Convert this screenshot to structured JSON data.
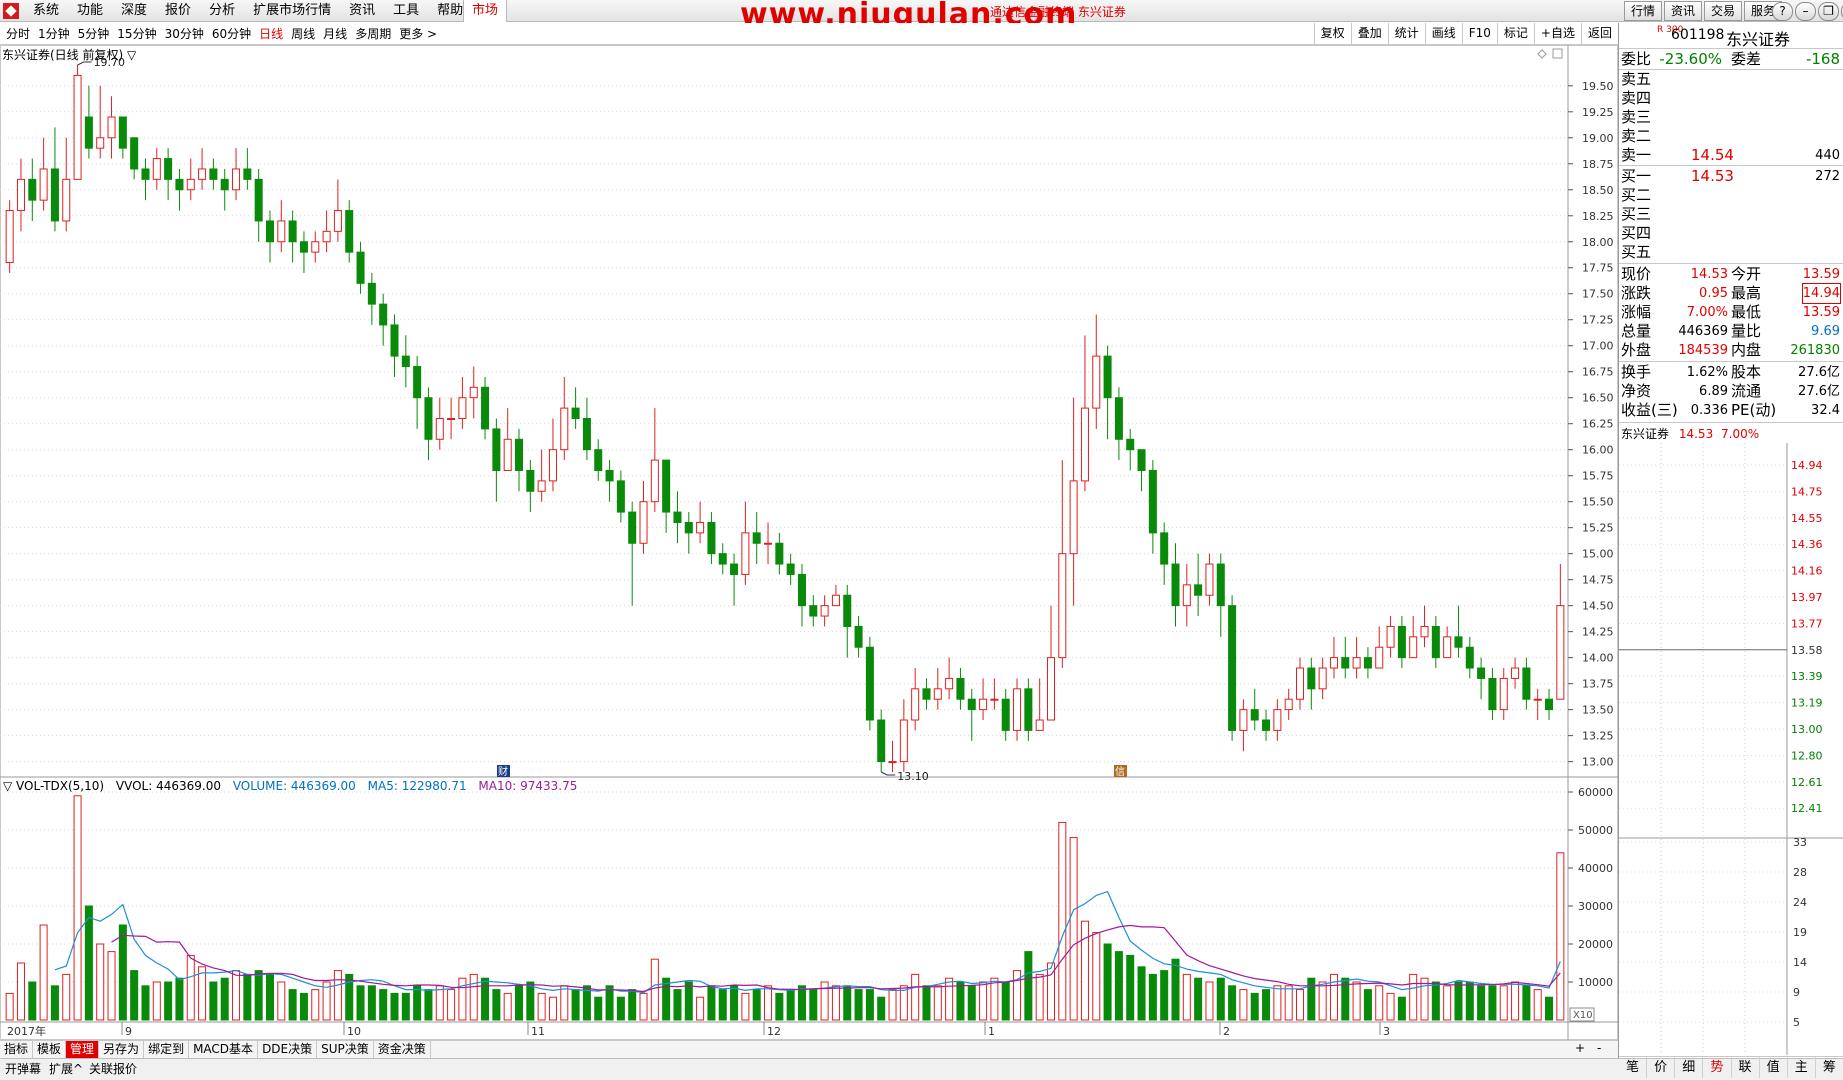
{
  "menubar": {
    "items": [
      "系统",
      "功能",
      "深度",
      "报价",
      "分析",
      "扩展市场行情",
      "资讯",
      "工具",
      "帮助"
    ],
    "market_tab": "市场",
    "watermark": "www.niugulan.com",
    "subtitle": "通达信金融终端 东兴证券",
    "right_buttons": [
      "行情",
      "资讯",
      "交易",
      "服务"
    ]
  },
  "periodbar": {
    "periods": [
      "分时",
      "1分钟",
      "5分钟",
      "15分钟",
      "30分钟",
      "60分钟",
      "日线",
      "周线",
      "月线",
      "多周期",
      "更多 >"
    ],
    "active": "日线",
    "tools": [
      "复权",
      "叠加",
      "统计",
      "画线",
      "F10",
      "标记",
      "+自选",
      "返回"
    ]
  },
  "main": {
    "title": "东兴证券(日线 前复权) ▽",
    "high_label": "19.70",
    "low_label": "13.10",
    "vol_legend": {
      "name": "▽ VOL-TDX(5,10)",
      "vvol": "VVOL: 446369.00",
      "volume": "VOLUME: 446369.00",
      "ma5": "MA5: 122980.71",
      "ma10": "MA10: 97433.75"
    },
    "vol_scale_label": "X10",
    "marker_cai": "财",
    "marker_qing": "信"
  },
  "bottom": {
    "tabs": [
      "指标",
      "模板",
      "管理",
      "另存为",
      "绑定到",
      "MACD基本",
      "DDE决策",
      "SUP决策",
      "资金决策"
    ],
    "active": "管理",
    "plus": "+",
    "minus": "-",
    "period": "日线",
    "status_items": [
      "开弹幕",
      "扩展^",
      "关联报价"
    ]
  },
  "stock": {
    "code": "601198",
    "name": "东兴证券",
    "tag": "R 300",
    "weibi_label": "委比",
    "weibi": "-23.60%",
    "weicha_label": "委差",
    "weicha": "-168",
    "asks": [
      {
        "label": "卖五",
        "price": "",
        "vol": ""
      },
      {
        "label": "卖四",
        "price": "",
        "vol": ""
      },
      {
        "label": "卖三",
        "price": "",
        "vol": ""
      },
      {
        "label": "卖二",
        "price": "",
        "vol": ""
      },
      {
        "label": "卖一",
        "price": "14.54",
        "vol": "440"
      }
    ],
    "bids": [
      {
        "label": "买一",
        "price": "14.53",
        "vol": "272"
      },
      {
        "label": "买二",
        "price": "",
        "vol": ""
      },
      {
        "label": "买三",
        "price": "",
        "vol": ""
      },
      {
        "label": "买四",
        "price": "",
        "vol": ""
      },
      {
        "label": "买五",
        "price": "",
        "vol": ""
      }
    ],
    "stats1": [
      {
        "l1": "现价",
        "v1": "14.53",
        "c1": "red",
        "l2": "今开",
        "v2": "13.59",
        "c2": "red"
      },
      {
        "l1": "涨跌",
        "v1": "0.95",
        "c1": "red",
        "l2": "最高",
        "v2": "14.94",
        "c2": "red"
      },
      {
        "l1": "涨幅",
        "v1": "7.00%",
        "c1": "red",
        "l2": "最低",
        "v2": "13.59",
        "c2": "red"
      },
      {
        "l1": "总量",
        "v1": "446369",
        "c1": "",
        "l2": "量比",
        "v2": "9.69",
        "c2": "blue"
      },
      {
        "l1": "外盘",
        "v1": "184539",
        "c1": "red",
        "l2": "内盘",
        "v2": "261830",
        "c2": "green"
      }
    ],
    "stats2": [
      {
        "l1": "换手",
        "v1": "1.62%",
        "l2": "股本",
        "v2": "27.6亿"
      },
      {
        "l1": "净资",
        "v1": "6.89",
        "l2": "流通",
        "v2": "27.6亿"
      },
      {
        "l1": "收益(三)",
        "v1": "0.336",
        "l2": "PE(动)",
        "v2": "32.4"
      }
    ],
    "mini_head": {
      "name": "东兴证券",
      "price": "14.53",
      "pct": "7.00%"
    },
    "mini_price_ticks": [
      "14.94",
      "14.75",
      "14.55",
      "14.36",
      "14.16",
      "13.97",
      "13.77",
      "13.58",
      "13.39",
      "13.19",
      "13.00",
      "12.80",
      "12.61",
      "12.41"
    ],
    "mini_vol_ticks": [
      "33",
      "28",
      "24",
      "19",
      "14",
      "9",
      "5"
    ],
    "right_tabs": [
      "笔",
      "价",
      "细",
      "势",
      "联",
      "值",
      "主",
      "筹"
    ],
    "right_tab_active": "势"
  },
  "chart_data": {
    "type": "candlestick",
    "x_axis_labels": [
      "2017年",
      "9",
      "10",
      "11",
      "12",
      "1",
      "2",
      "3"
    ],
    "price_ylim": [
      12.9,
      19.7
    ],
    "price_ticks": [
      "19.50",
      "19.25",
      "19.00",
      "18.75",
      "18.50",
      "18.25",
      "18.00",
      "17.75",
      "17.50",
      "17.25",
      "17.00",
      "16.75",
      "16.50",
      "16.25",
      "16.00",
      "15.75",
      "15.50",
      "15.25",
      "15.00",
      "14.75",
      "14.50",
      "14.25",
      "14.00",
      "13.75",
      "13.50",
      "13.25",
      "13.00"
    ],
    "volume_ylim": [
      0,
      60000
    ],
    "volume_ticks": [
      "60000",
      "50000",
      "40000",
      "30000",
      "20000",
      "10000"
    ],
    "candles": [
      [
        17.8,
        18.3,
        18.4,
        17.7,
        7000
      ],
      [
        18.3,
        18.6,
        18.8,
        18.1,
        15000
      ],
      [
        18.6,
        18.4,
        18.8,
        18.2,
        10000
      ],
      [
        18.4,
        18.7,
        19.0,
        18.3,
        25000
      ],
      [
        18.7,
        18.2,
        19.1,
        18.1,
        9000
      ],
      [
        18.2,
        18.6,
        19.0,
        18.1,
        12000
      ],
      [
        18.6,
        19.6,
        19.7,
        18.7,
        59000
      ],
      [
        19.2,
        18.9,
        19.5,
        18.8,
        30000
      ],
      [
        18.9,
        19.0,
        19.5,
        18.8,
        20000
      ],
      [
        19.0,
        19.2,
        19.4,
        18.8,
        18000
      ],
      [
        19.2,
        18.9,
        19.1,
        18.8,
        25000
      ],
      [
        19.0,
        18.7,
        19.0,
        18.6,
        13000
      ],
      [
        18.7,
        18.6,
        18.8,
        18.4,
        9000
      ],
      [
        18.6,
        18.8,
        18.9,
        18.5,
        10000
      ],
      [
        18.8,
        18.6,
        18.9,
        18.4,
        10000
      ],
      [
        18.6,
        18.5,
        18.7,
        18.3,
        11000
      ],
      [
        18.5,
        18.6,
        18.8,
        18.4,
        17000
      ],
      [
        18.6,
        18.7,
        18.9,
        18.5,
        14000
      ],
      [
        18.7,
        18.6,
        18.8,
        18.5,
        10000
      ],
      [
        18.6,
        18.5,
        18.7,
        18.3,
        11000
      ],
      [
        18.5,
        18.7,
        18.9,
        18.4,
        13000
      ],
      [
        18.7,
        18.6,
        18.9,
        18.5,
        12000
      ],
      [
        18.6,
        18.2,
        18.7,
        18.0,
        13000
      ],
      [
        18.2,
        18.0,
        18.3,
        17.8,
        12000
      ],
      [
        18.0,
        18.2,
        18.4,
        17.9,
        10000
      ],
      [
        18.2,
        18.0,
        18.3,
        17.8,
        8000
      ],
      [
        18.0,
        17.9,
        18.1,
        17.7,
        7000
      ],
      [
        17.9,
        18.0,
        18.1,
        17.8,
        8000
      ],
      [
        18.0,
        18.1,
        18.3,
        17.9,
        10000
      ],
      [
        18.1,
        18.3,
        18.6,
        18.0,
        13000
      ],
      [
        18.3,
        17.9,
        18.4,
        17.8,
        12000
      ],
      [
        17.9,
        17.6,
        18.0,
        17.5,
        9000
      ],
      [
        17.6,
        17.4,
        17.7,
        17.2,
        9000
      ],
      [
        17.4,
        17.2,
        17.5,
        17.0,
        8000
      ],
      [
        17.2,
        16.9,
        17.3,
        16.7,
        7000
      ],
      [
        16.9,
        16.8,
        17.1,
        16.6,
        7000
      ],
      [
        16.8,
        16.5,
        16.9,
        16.2,
        9000
      ],
      [
        16.5,
        16.1,
        16.6,
        15.9,
        8000
      ],
      [
        16.1,
        16.3,
        16.5,
        16.0,
        9000
      ],
      [
        16.3,
        16.3,
        16.5,
        16.1,
        8000
      ],
      [
        16.3,
        16.5,
        16.7,
        16.2,
        11000
      ],
      [
        16.5,
        16.6,
        16.8,
        16.3,
        12000
      ],
      [
        16.6,
        16.2,
        16.7,
        16.1,
        11000
      ],
      [
        16.2,
        15.8,
        16.3,
        15.5,
        8000
      ],
      [
        15.8,
        16.1,
        16.4,
        15.8,
        7000
      ],
      [
        16.1,
        15.8,
        16.2,
        15.6,
        9000
      ],
      [
        15.8,
        15.6,
        15.9,
        15.4,
        10000
      ],
      [
        15.6,
        15.7,
        16.0,
        15.5,
        7000
      ],
      [
        15.7,
        16.0,
        16.3,
        15.6,
        6000
      ],
      [
        16.0,
        16.4,
        16.7,
        15.9,
        9000
      ],
      [
        16.4,
        16.3,
        16.6,
        16.2,
        8000
      ],
      [
        16.3,
        16.0,
        16.5,
        15.9,
        9000
      ],
      [
        16.0,
        15.8,
        16.1,
        15.7,
        6000
      ],
      [
        15.8,
        15.7,
        15.9,
        15.5,
        9000
      ],
      [
        15.7,
        15.4,
        15.8,
        15.3,
        6000
      ],
      [
        15.4,
        15.1,
        15.5,
        14.5,
        8000
      ],
      [
        15.1,
        15.5,
        15.7,
        15.0,
        7000
      ],
      [
        15.5,
        15.9,
        16.4,
        15.4,
        16000
      ],
      [
        15.9,
        15.4,
        15.8,
        15.2,
        11000
      ],
      [
        15.4,
        15.3,
        15.6,
        15.1,
        8000
      ],
      [
        15.3,
        15.2,
        15.4,
        15.0,
        10000
      ],
      [
        15.2,
        15.3,
        15.5,
        15.1,
        6000
      ],
      [
        15.3,
        15.0,
        15.4,
        14.9,
        9000
      ],
      [
        15.0,
        14.9,
        15.1,
        14.8,
        8000
      ],
      [
        14.9,
        14.8,
        15.0,
        14.5,
        9000
      ],
      [
        14.8,
        15.2,
        15.5,
        14.7,
        7000
      ],
      [
        15.2,
        15.1,
        15.4,
        14.9,
        8000
      ],
      [
        15.1,
        15.1,
        15.3,
        14.9,
        9000
      ],
      [
        15.1,
        14.9,
        15.2,
        14.8,
        7000
      ],
      [
        14.9,
        14.8,
        15.0,
        14.7,
        8000
      ],
      [
        14.8,
        14.5,
        14.9,
        14.3,
        9000
      ],
      [
        14.5,
        14.4,
        14.6,
        14.3,
        8000
      ],
      [
        14.4,
        14.5,
        14.6,
        14.3,
        10000
      ],
      [
        14.5,
        14.6,
        14.7,
        14.5,
        9000
      ],
      [
        14.6,
        14.3,
        14.7,
        14.0,
        9000
      ],
      [
        14.3,
        14.1,
        14.4,
        14.0,
        8000
      ],
      [
        14.1,
        13.4,
        14.2,
        13.3,
        8000
      ],
      [
        13.4,
        13.0,
        13.5,
        12.9,
        6000
      ],
      [
        13.0,
        13.0,
        13.2,
        12.9,
        8000
      ],
      [
        13.0,
        13.4,
        13.6,
        12.9,
        9000
      ],
      [
        13.4,
        13.7,
        13.9,
        13.3,
        12000
      ],
      [
        13.7,
        13.6,
        13.8,
        13.5,
        9000
      ],
      [
        13.6,
        13.7,
        13.9,
        13.5,
        9000
      ],
      [
        13.7,
        13.8,
        14.0,
        13.6,
        11000
      ],
      [
        13.8,
        13.6,
        13.9,
        13.5,
        10000
      ],
      [
        13.6,
        13.5,
        13.7,
        13.2,
        9000
      ],
      [
        13.5,
        13.6,
        13.8,
        13.4,
        10000
      ],
      [
        13.6,
        13.6,
        13.8,
        13.5,
        11000
      ],
      [
        13.6,
        13.3,
        13.7,
        13.2,
        10000
      ],
      [
        13.3,
        13.7,
        13.8,
        13.2,
        13000
      ],
      [
        13.7,
        13.3,
        13.8,
        13.2,
        18000
      ],
      [
        13.3,
        13.4,
        13.8,
        13.3,
        12000
      ],
      [
        13.4,
        14.0,
        14.5,
        13.4,
        15000
      ],
      [
        14.0,
        15.0,
        15.9,
        13.9,
        52000
      ],
      [
        15.0,
        15.7,
        16.5,
        14.5,
        48000
      ],
      [
        15.7,
        16.4,
        17.1,
        15.6,
        26000
      ],
      [
        16.4,
        16.9,
        17.3,
        16.2,
        23000
      ],
      [
        16.9,
        16.5,
        17.0,
        16.1,
        20000
      ],
      [
        16.5,
        16.1,
        16.6,
        15.9,
        18000
      ],
      [
        16.1,
        16.0,
        16.2,
        15.8,
        17000
      ],
      [
        16.0,
        15.8,
        16.0,
        15.6,
        14000
      ],
      [
        15.8,
        15.2,
        15.9,
        15.0,
        12000
      ],
      [
        15.2,
        14.9,
        15.3,
        14.7,
        13000
      ],
      [
        14.9,
        14.5,
        15.1,
        14.3,
        16000
      ],
      [
        14.5,
        14.7,
        14.9,
        14.3,
        12000
      ],
      [
        14.7,
        14.6,
        15.0,
        14.4,
        11000
      ],
      [
        14.6,
        14.9,
        15.0,
        14.5,
        10000
      ],
      [
        14.9,
        14.5,
        15.0,
        14.2,
        11000
      ],
      [
        14.5,
        13.3,
        14.6,
        13.2,
        9000
      ],
      [
        13.3,
        13.5,
        13.6,
        13.1,
        8000
      ],
      [
        13.5,
        13.4,
        13.7,
        13.3,
        7000
      ],
      [
        13.4,
        13.3,
        13.5,
        13.2,
        8000
      ],
      [
        13.3,
        13.5,
        13.6,
        13.2,
        9000
      ],
      [
        13.5,
        13.6,
        13.7,
        13.4,
        9000
      ],
      [
        13.6,
        13.9,
        14.0,
        13.5,
        8000
      ],
      [
        13.9,
        13.7,
        14.0,
        13.5,
        11000
      ],
      [
        13.7,
        13.9,
        14.0,
        13.6,
        10000
      ],
      [
        13.9,
        14.0,
        14.2,
        13.8,
        12000
      ],
      [
        14.0,
        13.9,
        14.2,
        13.8,
        11000
      ],
      [
        13.9,
        14.0,
        14.2,
        13.8,
        10000
      ],
      [
        14.0,
        13.9,
        14.1,
        13.8,
        8000
      ],
      [
        13.9,
        14.1,
        14.3,
        13.9,
        9000
      ],
      [
        14.1,
        14.3,
        14.4,
        14.0,
        7000
      ],
      [
        14.3,
        14.0,
        14.4,
        13.9,
        6000
      ],
      [
        14.0,
        14.2,
        14.4,
        14.0,
        12000
      ],
      [
        14.2,
        14.3,
        14.5,
        14.1,
        11000
      ],
      [
        14.3,
        14.0,
        14.4,
        13.9,
        10000
      ],
      [
        14.0,
        14.2,
        14.3,
        14.0,
        9000
      ],
      [
        14.2,
        14.1,
        14.5,
        14.0,
        10000
      ],
      [
        14.1,
        13.9,
        14.2,
        13.8,
        10000
      ],
      [
        13.9,
        13.8,
        14.0,
        13.6,
        9000
      ],
      [
        13.8,
        13.5,
        13.9,
        13.4,
        9000
      ],
      [
        13.5,
        13.8,
        13.9,
        13.4,
        9000
      ],
      [
        13.8,
        13.9,
        14.0,
        13.7,
        10000
      ],
      [
        13.9,
        13.6,
        14.0,
        13.5,
        9000
      ],
      [
        13.6,
        13.6,
        13.7,
        13.4,
        8000
      ],
      [
        13.6,
        13.5,
        13.7,
        13.4,
        6000
      ],
      [
        13.6,
        14.5,
        14.9,
        13.6,
        44000
      ]
    ]
  }
}
